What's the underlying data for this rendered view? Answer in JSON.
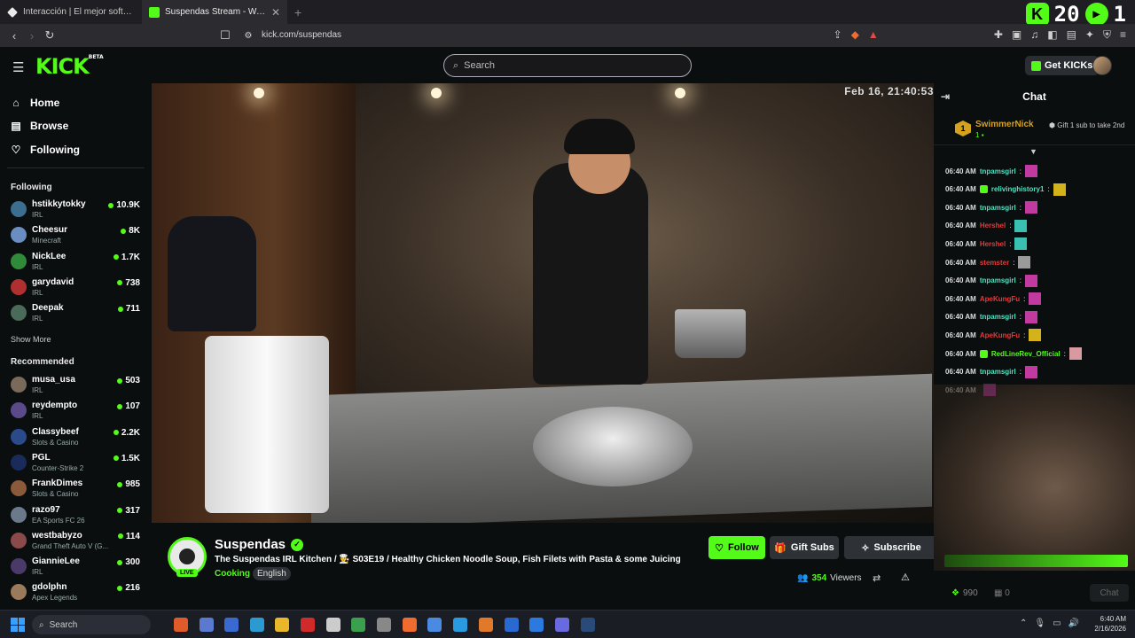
{
  "browser": {
    "tabs": [
      {
        "title": "Interacción | El mejor software para p",
        "active": false
      },
      {
        "title": "Suspendas Stream - Watch Li",
        "active": true
      }
    ],
    "url": "kick.com/suspendas",
    "overlay_counter_left": "20",
    "overlay_counter_right": "1"
  },
  "header": {
    "logo": "KICK",
    "logo_badge": "BETA",
    "search_placeholder": "Search",
    "get_kicks_label": "Get KICKs"
  },
  "sidebar": {
    "nav": [
      {
        "label": "Home",
        "icon": "home-icon"
      },
      {
        "label": "Browse",
        "icon": "browse-icon"
      },
      {
        "label": "Following",
        "icon": "heart-icon"
      }
    ],
    "following_title": "Following",
    "following": [
      {
        "name": "hstikkytokky",
        "category": "IRL",
        "viewers": "10.9K",
        "color": "#3b6e8f"
      },
      {
        "name": "Cheesur",
        "category": "Minecraft",
        "viewers": "8K",
        "color": "#6b8ec2"
      },
      {
        "name": "NickLee",
        "category": "IRL",
        "viewers": "1.7K",
        "color": "#2f8a3a"
      },
      {
        "name": "garydavid",
        "category": "IRL",
        "viewers": "738",
        "color": "#b03030"
      },
      {
        "name": "Deepak",
        "category": "IRL",
        "viewers": "711",
        "color": "#4a6a5a"
      }
    ],
    "show_more": "Show More",
    "recommended_title": "Recommended",
    "recommended": [
      {
        "name": "musa_usa",
        "category": "IRL",
        "viewers": "503",
        "color": "#7a6a5a"
      },
      {
        "name": "reydempto",
        "category": "IRL",
        "viewers": "107",
        "color": "#5a4a8a"
      },
      {
        "name": "Classybeef",
        "category": "Slots & Casino",
        "viewers": "2.2K",
        "color": "#2a4a8a"
      },
      {
        "name": "PGL",
        "category": "Counter-Strike 2",
        "viewers": "1.5K",
        "color": "#1a2a5a"
      },
      {
        "name": "FrankDimes",
        "category": "Slots & Casino",
        "viewers": "985",
        "color": "#8a5a3a"
      },
      {
        "name": "razo97",
        "category": "EA Sports FC 26",
        "viewers": "317",
        "color": "#6a7a8a"
      },
      {
        "name": "westbabyzo",
        "category": "Grand Theft Auto V (G...",
        "viewers": "114",
        "color": "#8a4a4a"
      },
      {
        "name": "GiannieLee",
        "category": "IRL",
        "viewers": "300",
        "color": "#4a3a6a"
      },
      {
        "name": "gdolphn",
        "category": "Apex Legends",
        "viewers": "216",
        "color": "#9a7a5a"
      }
    ]
  },
  "video": {
    "timestamp": "Feb 16, 21:40:53"
  },
  "stream": {
    "channel": "Suspendas",
    "live_label": "LIVE",
    "title": "The Suspendas IRL Kitchen / 👨‍🍳 S03E19 / Healthy Chicken Noodle Soup, Fish Filets with Pasta & some Juicing",
    "category": "Cooking",
    "language": "English",
    "follow_label": "Follow",
    "gift_label": "Gift Subs",
    "subscribe_label": "Subscribe",
    "viewers_count": "354",
    "viewers_label": "Viewers"
  },
  "chat": {
    "title": "Chat",
    "pinned": {
      "rank": "1",
      "name": "SwimmerNick",
      "sub_count": "1",
      "gift_text": "Gift 1 sub to take 2nd"
    },
    "messages": [
      {
        "time": "06:40 AM",
        "user": "tnpamsgirl",
        "color": "#53e0c0",
        "emote": "#c03aa0"
      },
      {
        "time": "06:40 AM",
        "user": "relivinghistory1",
        "color": "#53e0c0",
        "emote": "#d4b21a",
        "badge": true
      },
      {
        "time": "06:40 AM",
        "user": "tnpamsgirl",
        "color": "#53e0c0",
        "emote": "#c03aa0"
      },
      {
        "time": "06:40 AM",
        "user": "Hershel",
        "color": "#e03a3a",
        "emote": "#3ac0b0"
      },
      {
        "time": "06:40 AM",
        "user": "Hershel",
        "color": "#e03a3a",
        "emote": "#3ac0b0"
      },
      {
        "time": "06:40 AM",
        "user": "stemster",
        "color": "#e03a3a",
        "emote": "#9a9a9a"
      },
      {
        "time": "06:40 AM",
        "user": "tnpamsgirl",
        "color": "#53e0c0",
        "emote": "#c03aa0"
      },
      {
        "time": "06:40 AM",
        "user": "ApeKungFu",
        "color": "#e03a3a",
        "emote": "#c03aa0"
      },
      {
        "time": "06:40 AM",
        "user": "tnpamsgirl",
        "color": "#53e0c0",
        "emote": "#c03aa0"
      },
      {
        "time": "06:40 AM",
        "user": "ApeKungFu",
        "color": "#e03a3a",
        "emote": "#d4b21a"
      },
      {
        "time": "06:40 AM",
        "user": "RedLineRev_Official",
        "color": "#53fc18",
        "emote": "#d89aa0",
        "badge": true
      },
      {
        "time": "06:40 AM",
        "user": "tnpamsgirl",
        "color": "#53e0c0",
        "emote": "#c03aa0"
      },
      {
        "time": "06:40 AM",
        "user": "",
        "color": "#53e0c0",
        "emote": "#c03aa0"
      }
    ],
    "kicks_count": "990",
    "second_count": "0",
    "chat_button": "Chat"
  },
  "taskbar": {
    "search_label": "Search",
    "time": "6:40 AM",
    "date": "2/16/2026"
  }
}
